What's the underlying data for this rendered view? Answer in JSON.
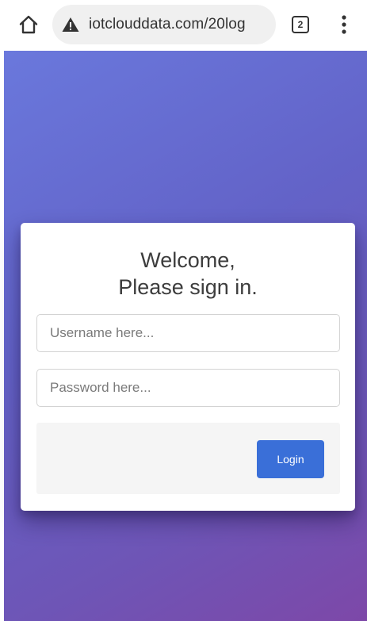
{
  "browser": {
    "url": "iotclouddata.com/20log",
    "tab_count": "2",
    "icons": {
      "home": "home-icon",
      "security": "warning-icon",
      "menu": "more-vert-icon"
    }
  },
  "login": {
    "title_line1": "Welcome,",
    "title_line2": "Please sign in.",
    "username_placeholder": "Username here...",
    "password_placeholder": "Password here...",
    "login_label": "Login"
  },
  "colors": {
    "gradient_start": "#6a78dc",
    "gradient_end": "#7d48a8",
    "button": "#3a6fd8",
    "footer_bg": "#f5f5f5"
  }
}
